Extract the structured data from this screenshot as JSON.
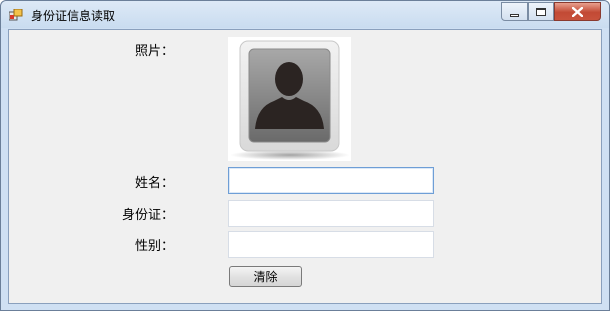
{
  "window": {
    "title": "身份证信息读取",
    "controls": [
      "minimize",
      "maximize",
      "close"
    ]
  },
  "form": {
    "photo_label": "照片：",
    "name_label": "姓名：",
    "id_label": "身份证：",
    "sex_label": "性别：",
    "name_value": "",
    "id_value": "",
    "sex_value": "",
    "clear_label": "清除"
  },
  "icons": {
    "app": "app-window-icon",
    "photo": "person-silhouette-icon"
  },
  "colors": {
    "close_button": "#c8523c",
    "client_background": "#f0f0f0",
    "focus_border": "#6e9ed6"
  }
}
